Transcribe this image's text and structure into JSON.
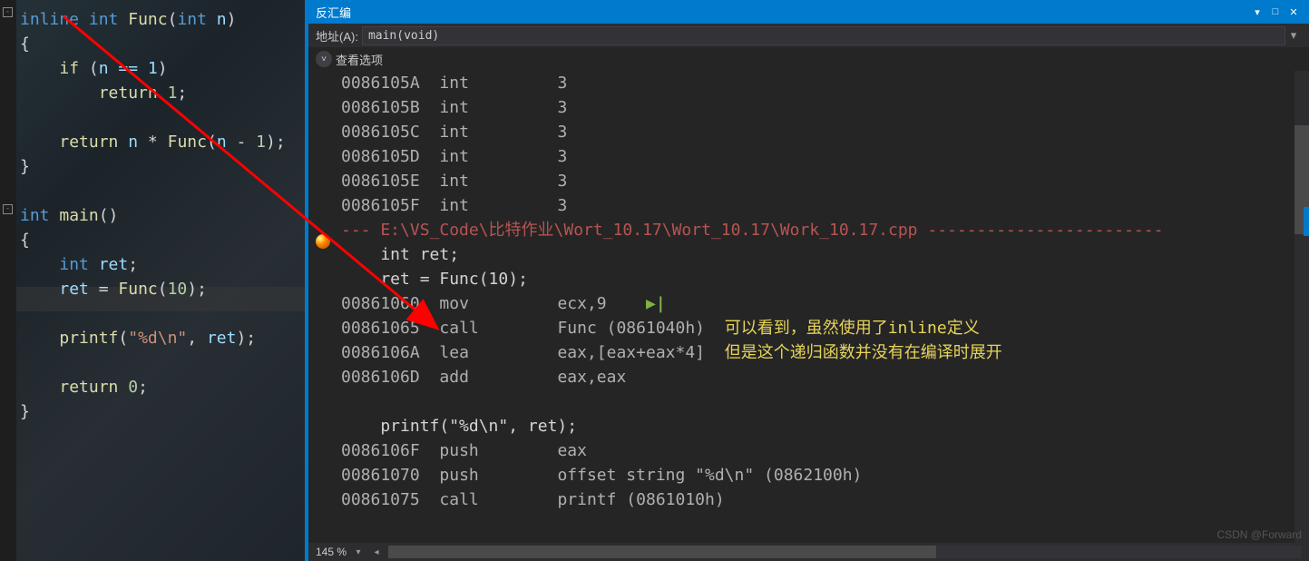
{
  "code": {
    "funcDecl": {
      "inline": "inline",
      "int": "int",
      "name": "Func",
      "paramType": "int",
      "paramName": "n"
    },
    "ifCond": {
      "if": "if",
      "expr": "n == 1"
    },
    "ret1": {
      "return": "return",
      "val": "1"
    },
    "retRec": {
      "return": "return",
      "expr1": "n",
      "star": "*",
      "fn": "Func",
      "lp": "(",
      "n": "n",
      "minus": " - ",
      "one": "1",
      "rp": ")"
    },
    "mainDecl": {
      "int": "int",
      "name": "main"
    },
    "retDecl": {
      "int": "int",
      "name": "ret"
    },
    "assign": {
      "lhs": "ret",
      "eq": " = ",
      "fn": "Func",
      "arg": "10"
    },
    "printf": {
      "fn": "printf",
      "fmt": "\"%d\\n\"",
      "arg": "ret"
    },
    "ret0": {
      "return": "return",
      "val": "0"
    }
  },
  "disasm": {
    "title": "反汇编",
    "addrLabel": "地址(A):",
    "addrValue": "main(void)",
    "optsLabel": "查看选项",
    "lines": [
      {
        "addr": "0086105A",
        "mnem": "int",
        "oper": "3"
      },
      {
        "addr": "0086105B",
        "mnem": "int",
        "oper": "3"
      },
      {
        "addr": "0086105C",
        "mnem": "int",
        "oper": "3"
      },
      {
        "addr": "0086105D",
        "mnem": "int",
        "oper": "3"
      },
      {
        "addr": "0086105E",
        "mnem": "int",
        "oper": "3"
      },
      {
        "addr": "0086105F",
        "mnem": "int",
        "oper": "3"
      }
    ],
    "srcSep": "--- E:\\VS_Code\\比特作业\\Wort_10.17\\Wort_10.17\\Work_10.17.cpp ------------------------",
    "srcLines": [
      "    int ret;",
      "    ret = Func(10);"
    ],
    "bpLine": {
      "addr": "00861060",
      "mnem": "mov",
      "oper": "ecx,9"
    },
    "postLines": [
      {
        "addr": "00861065",
        "mnem": "call",
        "oper": "Func (0861040h)",
        "annot": "可以看到，虽然使用了inline定义"
      },
      {
        "addr": "0086106A",
        "mnem": "lea",
        "oper": "eax,[eax+eax*4]",
        "annot": "但是这个递归函数并没有在编译时展开"
      },
      {
        "addr": "0086106D",
        "mnem": "add",
        "oper": "eax,eax"
      }
    ],
    "srcPrintf": "    printf(\"%d\\n\", ret);",
    "tailLines": [
      {
        "addr": "0086106F",
        "mnem": "push",
        "oper": "eax"
      },
      {
        "addr": "00861070",
        "mnem": "push",
        "oper": "offset string \"%d\\n\" (0862100h)"
      },
      {
        "addr": "00861075",
        "mnem": "call",
        "oper": "printf (0861010h)"
      }
    ],
    "zoom": "145 %"
  },
  "watermark": "CSDN @Forward"
}
